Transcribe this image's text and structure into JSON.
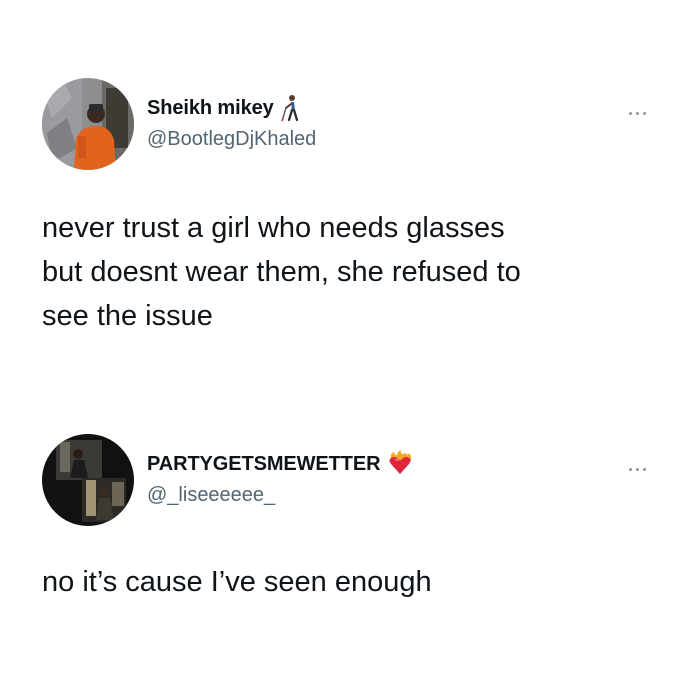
{
  "tweets": [
    {
      "display_name": "Sheikh mikey",
      "name_emoji": "person-with-cane-emoji",
      "handle": "@BootlegDjKhaled",
      "text": "never trust a girl who needs glasses\nbut doesnt wear them, she refused to\nsee the issue"
    },
    {
      "display_name": "PARTYGETSMEWETTER",
      "name_emoji": "heart-on-fire-emoji",
      "handle": "@_liseeeeee_",
      "text": "no it’s cause I’ve seen enough"
    }
  ],
  "colors": {
    "background": "#ffffff",
    "text_primary": "#0f1419",
    "text_secondary": "#536471",
    "more_dots": "#8b98a5"
  },
  "icons": {
    "more": "more-options-icon"
  }
}
